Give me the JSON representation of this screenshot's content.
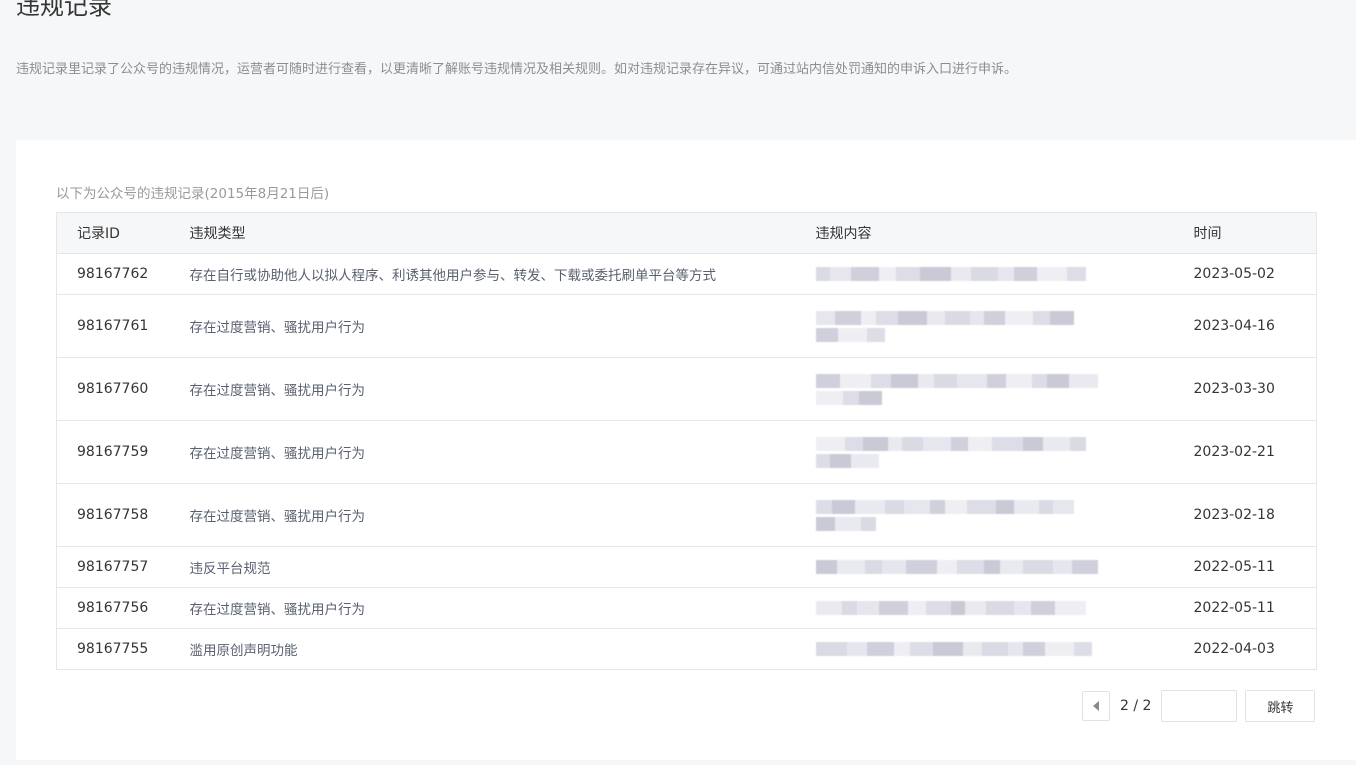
{
  "page": {
    "title": "违规记录",
    "description": "违规记录里记录了公众号的违规情况，运营者可随时进行查看，以更清晰了解账号违规情况及相关规则。如对违规记录存在异议，可通过站内信处罚通知的申诉入口进行申诉。"
  },
  "section": {
    "caption": "以下为公众号的违规记录(2015年8月21日后)"
  },
  "table": {
    "headers": [
      "记录ID",
      "违规类型",
      "违规内容",
      "时间"
    ],
    "rows": [
      {
        "id": "98167762",
        "type": "存在自行或协助他人以拟人程序、利诱其他用户参与、转发、下载或委托刷单平台等方式",
        "content": "",
        "time": "2023-05-02"
      },
      {
        "id": "98167761",
        "type": "存在过度营销、骚扰用户行为",
        "content": "",
        "time": "2023-04-16"
      },
      {
        "id": "98167760",
        "type": "存在过度营销、骚扰用户行为",
        "content": "",
        "time": "2023-03-30"
      },
      {
        "id": "98167759",
        "type": "存在过度营销、骚扰用户行为",
        "content": "",
        "time": "2023-02-21"
      },
      {
        "id": "98167758",
        "type": "存在过度营销、骚扰用户行为",
        "content": "",
        "time": "2023-02-18"
      },
      {
        "id": "98167757",
        "type": "违反平台规范",
        "content": "",
        "time": "2022-05-11"
      },
      {
        "id": "98167756",
        "type": "存在过度营销、骚扰用户行为",
        "content": "",
        "time": "2022-05-11"
      },
      {
        "id": "98167755",
        "type": "滥用原创声明功能",
        "content": "",
        "time": "2022-04-03"
      }
    ]
  },
  "pagination": {
    "current_of_total": "2 / 2",
    "jump_label": "跳转",
    "jump_input_value": ""
  }
}
